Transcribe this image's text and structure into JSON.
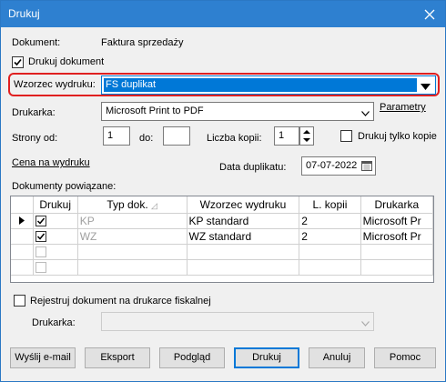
{
  "window": {
    "title": "Drukuj"
  },
  "document": {
    "label": "Dokument:",
    "value": "Faktura sprzedaży"
  },
  "print_document": {
    "label": "Drukuj dokument",
    "checked": true
  },
  "template": {
    "label": "Wzorzec wydruku:",
    "value": "FS duplikat"
  },
  "printer": {
    "label": "Drukarka:",
    "value": "Microsoft Print to PDF",
    "parameters_link": "Parametry"
  },
  "pages": {
    "from_label": "Strony od:",
    "from_value": "1",
    "to_label": "do:",
    "to_value": "",
    "copies_label": "Liczba kopii:",
    "copies_value": "1"
  },
  "print_copy_only": {
    "label": "Drukuj tylko kopie",
    "checked": false
  },
  "price_on_print_link": "Cena na wydruku",
  "duplicate_date": {
    "label": "Data duplikatu:",
    "value": "07-07-2022"
  },
  "related_docs": {
    "label": "Dokumenty powiązane:",
    "columns": [
      "Drukuj",
      "Typ dok.",
      "Wzorzec wydruku",
      "L. kopii",
      "Drukarka"
    ],
    "rows": [
      {
        "print": true,
        "type": "KP",
        "template": "KP standard",
        "copies": "2",
        "printer": "Microsoft Pr",
        "current": true
      },
      {
        "print": true,
        "type": "WZ",
        "template": "WZ standard",
        "copies": "2",
        "printer": "Microsoft Pr",
        "current": false
      },
      {
        "print": false,
        "type": "",
        "template": "",
        "copies": "",
        "printer": "",
        "current": false
      },
      {
        "print": false,
        "type": "",
        "template": "",
        "copies": "",
        "printer": "",
        "current": false
      }
    ]
  },
  "fiscal": {
    "label": "Rejestruj dokument na drukarce fiskalnej",
    "checked": false,
    "printer_label": "Drukarka:",
    "printer_value": ""
  },
  "buttons": {
    "email": "Wyślij e-mail",
    "export": "Eksport",
    "preview": "Podgląd",
    "print": "Drukuj",
    "cancel": "Anuluj",
    "help": "Pomoc"
  },
  "colors": {
    "titlebar": "#2e80d0",
    "selection": "#0078d7",
    "highlight_border": "#e02020"
  }
}
